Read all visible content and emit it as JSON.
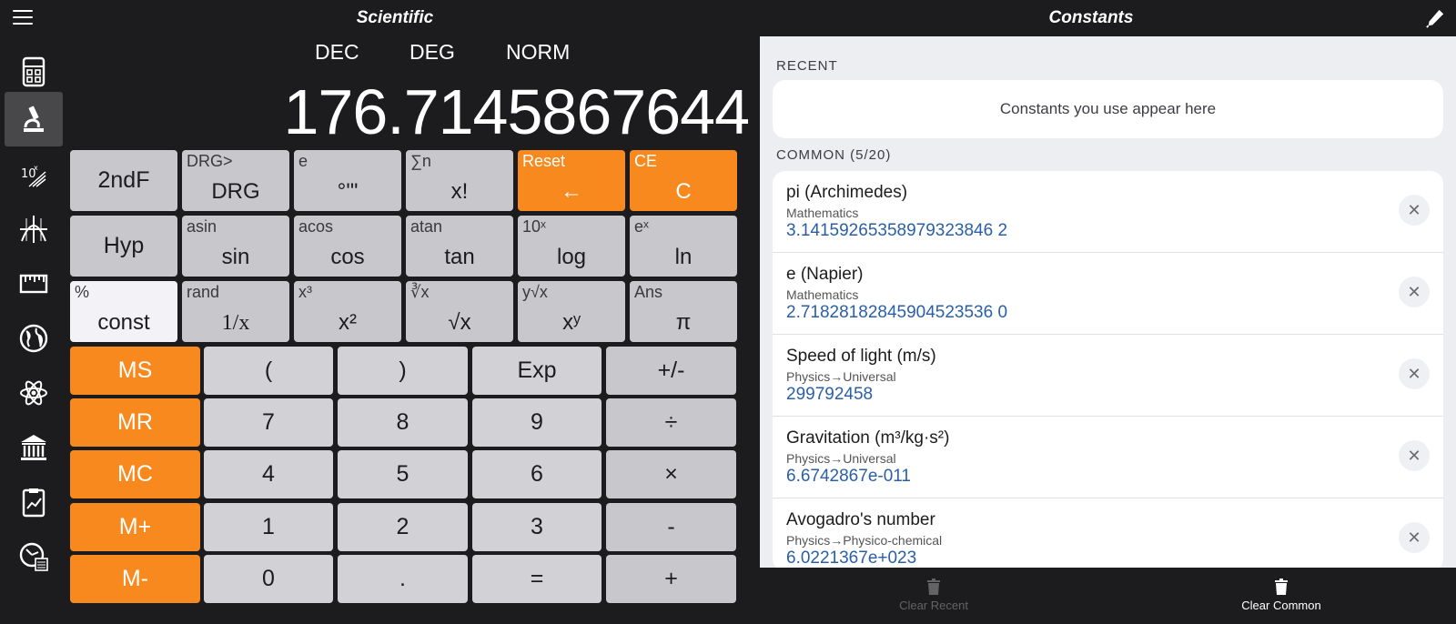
{
  "header": {
    "left_title": "Scientific",
    "right_title": "Constants",
    "menu_icon": "hamburger-icon",
    "edit_icon": "pen-icon"
  },
  "sidebar": {
    "items": [
      {
        "icon": "calculator-icon",
        "active": false
      },
      {
        "icon": "microscope-icon",
        "active": true
      },
      {
        "icon": "scientific-notation-icon",
        "active": false
      },
      {
        "icon": "graph-icon",
        "active": false
      },
      {
        "icon": "ruler-icon",
        "active": false
      },
      {
        "icon": "globe-icon",
        "active": false
      },
      {
        "icon": "atom-icon",
        "active": false
      },
      {
        "icon": "bank-icon",
        "active": false
      },
      {
        "icon": "chart-clipboard-icon",
        "active": false
      },
      {
        "icon": "clock-calculator-icon",
        "active": false
      }
    ]
  },
  "calculator": {
    "modes": [
      "DEC",
      "DEG",
      "NORM"
    ],
    "display": "176.7145867644",
    "sci_rows": [
      [
        {
          "sub": "",
          "main": "2ndF"
        },
        {
          "sub": "DRG>",
          "main": "DRG"
        },
        {
          "sub": "e",
          "main": "°'\""
        },
        {
          "sub": "∑n",
          "main": "x!"
        },
        {
          "sub": "Reset",
          "main": "←"
        },
        {
          "sub": "CE",
          "main": "C"
        }
      ],
      [
        {
          "sub": "",
          "main": "Hyp"
        },
        {
          "sub": "asin",
          "main": "sin"
        },
        {
          "sub": "acos",
          "main": "cos"
        },
        {
          "sub": "atan",
          "main": "tan"
        },
        {
          "sub": "10ˣ",
          "main": "log"
        },
        {
          "sub": "eˣ",
          "main": "ln"
        }
      ],
      [
        {
          "sub": "%",
          "main": "const"
        },
        {
          "sub": "rand",
          "main": "1/x"
        },
        {
          "sub": "x³",
          "main": "x²"
        },
        {
          "sub": "∛x",
          "main": "√x"
        },
        {
          "sub": "y√x",
          "main": "xʸ"
        },
        {
          "sub": "Ans",
          "main": "π"
        }
      ]
    ],
    "num_rows": [
      [
        "MS",
        "(",
        ")",
        "Exp",
        "+/-"
      ],
      [
        "MR",
        "7",
        "8",
        "9",
        "÷"
      ],
      [
        "MC",
        "4",
        "5",
        "6",
        "×"
      ],
      [
        "M+",
        "1",
        "2",
        "3",
        "-"
      ],
      [
        "M-",
        "0",
        ".",
        "=",
        "+"
      ]
    ]
  },
  "constants": {
    "recent_label": "RECENT",
    "recent_placeholder": "Constants you use appear here",
    "common_label": "COMMON (5/20)",
    "items": [
      {
        "name": "pi (Archimedes)",
        "category": "Mathematics",
        "value": "3.14159265358979323846 2"
      },
      {
        "name": "e (Napier)",
        "category": "Mathematics",
        "value": "2.71828182845904523536 0"
      },
      {
        "name": "Speed of light (m/s)",
        "category": "Physics→Universal",
        "value": "299792458"
      },
      {
        "name": "Gravitation (m³/kg·s²)",
        "category": "Physics→Universal",
        "value": "6.6742867e-011"
      },
      {
        "name": "Avogadro's number",
        "category": "Physics→Physico-chemical",
        "value": "6.0221367e+023"
      }
    ],
    "close_glyph": "✕"
  },
  "bottom": {
    "clear_recent": "Clear Recent",
    "clear_common": "Clear Common"
  },
  "colors": {
    "accent_orange": "#f7891e",
    "link_blue": "#2a5fa8",
    "dark_bg": "#1c1c1e"
  }
}
